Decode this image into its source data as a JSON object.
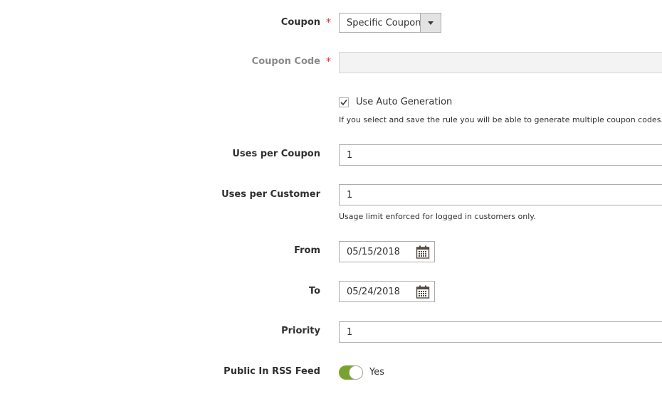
{
  "coupon": {
    "label": "Coupon",
    "required_mark": "*",
    "selected": "Specific Coupon"
  },
  "coupon_code": {
    "label": "Coupon Code",
    "required_mark": "*",
    "value": ""
  },
  "auto_generation": {
    "label": "Use Auto Generation",
    "checked": true,
    "note": "If you select and save the rule you will be able to generate multiple coupon codes."
  },
  "uses_per_coupon": {
    "label": "Uses per Coupon",
    "value": "1"
  },
  "uses_per_customer": {
    "label": "Uses per Customer",
    "value": "1",
    "note": "Usage limit enforced for logged in customers only."
  },
  "from": {
    "label": "From",
    "value": "05/15/2018"
  },
  "to": {
    "label": "To",
    "value": "05/24/2018"
  },
  "priority": {
    "label": "Priority",
    "value": "1"
  },
  "rss_feed": {
    "label": "Public In RSS Feed",
    "state_label": "Yes",
    "enabled": true
  },
  "colors": {
    "required": "#e22626",
    "toggle_on": "#79a22e"
  }
}
